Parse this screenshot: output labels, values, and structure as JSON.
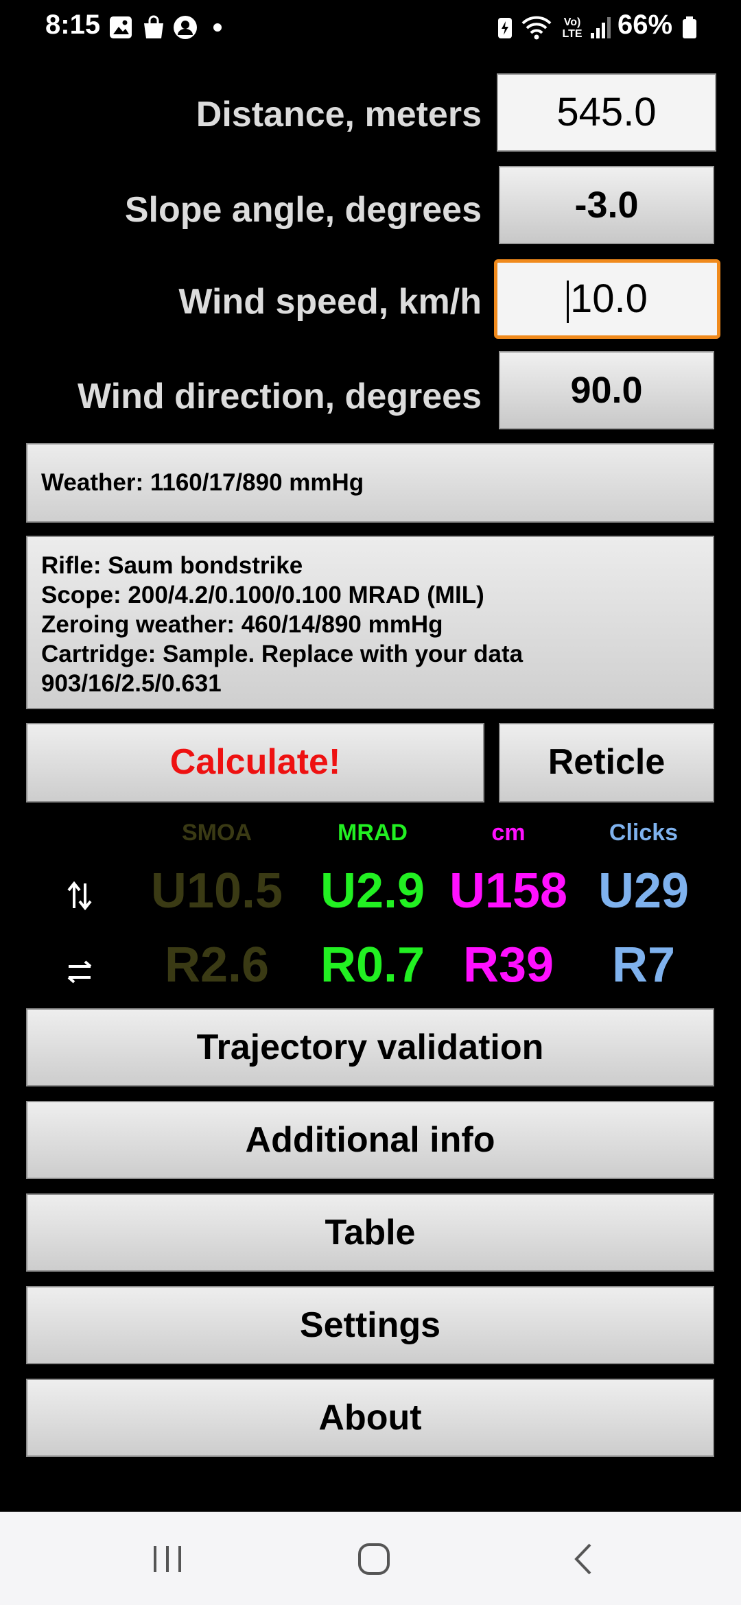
{
  "status_bar": {
    "time": "8:15",
    "battery_percent": "66%"
  },
  "fields": {
    "distance": {
      "label": "Distance, meters",
      "value": "545.0"
    },
    "slope": {
      "label": "Slope angle, degrees",
      "value": "-3.0"
    },
    "wind_speed": {
      "label": "Wind speed, km/h",
      "value": "10.0"
    },
    "wind_direction": {
      "label": "Wind direction, degrees",
      "value": "90.0"
    }
  },
  "weather": {
    "text": "Weather: 1160/17/890 mmHg"
  },
  "profile": {
    "lines": [
      "Rifle: Saum bondstrike",
      "Scope: 200/4.2/0.100/0.100 MRAD (MIL)",
      "Zeroing weather: 460/14/890 mmHg",
      "Cartridge: Sample. Replace with your data",
      "903/16/2.5/0.631"
    ]
  },
  "actions": {
    "calculate": "Calculate!",
    "reticle": "Reticle"
  },
  "results": {
    "headers": {
      "smoa": "SMOA",
      "mrad": "MRAD",
      "cm": "cm",
      "clicks": "Clicks"
    },
    "vertical": {
      "icon": "up-down-arrows-icon",
      "smoa": "U10.5",
      "mrad": "U2.9",
      "cm": "U158",
      "clicks": "U29"
    },
    "horizontal": {
      "icon": "left-right-arrows-icon",
      "smoa": "R2.6",
      "mrad": "R0.7",
      "cm": "R39",
      "clicks": "R7"
    },
    "colors": {
      "smoa": "#3a3a14",
      "mrad": "#22f022",
      "cm": "#ff10ff",
      "clicks": "#7fb2ee"
    }
  },
  "menu": {
    "trajectory": "Trajectory validation",
    "additional": "Additional info",
    "table": "Table",
    "settings": "Settings",
    "about": "About"
  },
  "colors": {
    "calculate_text": "#ee1111",
    "focus_border": "#f08a1c"
  }
}
